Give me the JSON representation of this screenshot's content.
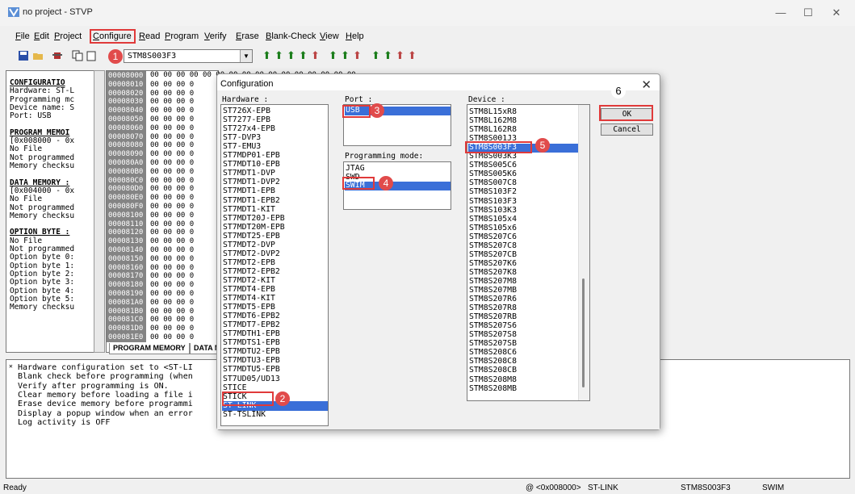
{
  "window": {
    "title": "no project - STVP",
    "min": "—",
    "max": "☐",
    "close": "✕"
  },
  "menu": [
    "File",
    "Edit",
    "Project",
    "Configure",
    "Read",
    "Program",
    "Verify",
    "Erase",
    "Blank-Check",
    "View",
    "Help"
  ],
  "toolbar": {
    "device": "STM8S003F3"
  },
  "left_panel": {
    "lines": [
      "CONFIGURATIO",
      "Hardware: ST-L",
      "Programming mc",
      "Device name: S",
      "Port: USB",
      "",
      "PROGRAM MEMOI",
      "[0x008000 - 0x",
      "No File",
      "Not programmed",
      "Memory checksu",
      "",
      "DATA MEMORY :",
      "[0x004000 - 0x",
      "No File",
      "Not programmed",
      "Memory checksu",
      "",
      "OPTION BYTE :",
      "No File",
      "Not programmed",
      "Option byte 0:",
      "Option byte 1:",
      "Option byte 2:",
      "Option byte 3:",
      "Option byte 4:",
      "Option byte 5:",
      "Memory checksu"
    ]
  },
  "hex": {
    "top_row": "00 00 00 00 00 00 00 00 00 00 00 00 00 00 00 00",
    "addresses": [
      "00008000",
      "00008010",
      "00008020",
      "00008030",
      "00008040",
      "00008050",
      "00008060",
      "00008070",
      "00008080",
      "00008090",
      "000080A0",
      "000080B0",
      "000080C0",
      "000080D0",
      "000080E0",
      "000080F0",
      "00008100",
      "00008110",
      "00008120",
      "00008130",
      "00008140",
      "00008150",
      "00008160",
      "00008170",
      "00008180",
      "00008190",
      "000081A0",
      "000081B0",
      "000081C0",
      "000081D0",
      "000081E0"
    ],
    "row_prefix": "00 00 00 0"
  },
  "tabs": [
    "PROGRAM MEMORY",
    "DATA M"
  ],
  "log": [
    "Hardware configuration set to <ST-LI",
    "Blank check before programming (when",
    "Verify after programming is ON.",
    "Clear memory before loading a file i",
    "Erase device memory before programmi",
    "Display a popup window when an error",
    "Log activity is OFF"
  ],
  "status": {
    "ready": "Ready",
    "address": "@ <0x008000>",
    "hardware": "ST-LINK",
    "device": "STM8S003F3",
    "mode": "SWIM"
  },
  "dialog": {
    "title": "Configuration",
    "close": "✕",
    "hardware_label": "Hardware :",
    "hardware": [
      "ST726X-EPB",
      "ST7277-EPB",
      "ST727x4-EPB",
      "ST7-DVP3",
      "ST7-EMU3",
      "ST7MDP01-EPB",
      "ST7MDT10-EPB",
      "ST7MDT1-DVP",
      "ST7MDT1-DVP2",
      "ST7MDT1-EPB",
      "ST7MDT1-EPB2",
      "ST7MDT1-KIT",
      "ST7MDT20J-EPB",
      "ST7MDT20M-EPB",
      "ST7MDT25-EPB",
      "ST7MDT2-DVP",
      "ST7MDT2-DVP2",
      "ST7MDT2-EPB",
      "ST7MDT2-EPB2",
      "ST7MDT2-KIT",
      "ST7MDT4-EPB",
      "ST7MDT4-KIT",
      "ST7MDT5-EPB",
      "ST7MDT6-EPB2",
      "ST7MDT7-EPB2",
      "ST7MDTH1-EPB",
      "ST7MDTS1-EPB",
      "ST7MDTU2-EPB",
      "ST7MDTU3-EPB",
      "ST7MDTU5-EPB",
      "ST7UD05/UD13",
      "STICE",
      "STICK",
      "ST-LINK",
      "ST-TSLINK"
    ],
    "hardware_selected": "ST-LINK",
    "port_label": "Port :",
    "port": [
      "USB"
    ],
    "mode_label": "Programming mode:",
    "modes": [
      "JTAG",
      "SWD",
      "SWIM"
    ],
    "device_label": "Device :",
    "devices": [
      "STM8L15xR8",
      "STM8L162M8",
      "STM8L162R8",
      "STM8S001J3",
      "STM8S003F3",
      "STM8S003K3",
      "STM8S005C6",
      "STM8S005K6",
      "STM8S007C8",
      "STM8S103F2",
      "STM8S103F3",
      "STM8S103K3",
      "STM8S105x4",
      "STM8S105x6",
      "STM8S207C6",
      "STM8S207C8",
      "STM8S207CB",
      "STM8S207K6",
      "STM8S207K8",
      "STM8S207M8",
      "STM8S207MB",
      "STM8S207R6",
      "STM8S207R8",
      "STM8S207RB",
      "STM8S207S6",
      "STM8S207S8",
      "STM8S207SB",
      "STM8S208C6",
      "STM8S208C8",
      "STM8S208CB",
      "STM8S208M8",
      "STM8S208MB"
    ],
    "ok": "OK",
    "cancel": "Cancel"
  },
  "annotations": [
    "1",
    "2",
    "3",
    "4",
    "5",
    "6"
  ],
  "colors": {
    "highlight": "#3a6fd8",
    "annotation": "#e14b4b"
  }
}
